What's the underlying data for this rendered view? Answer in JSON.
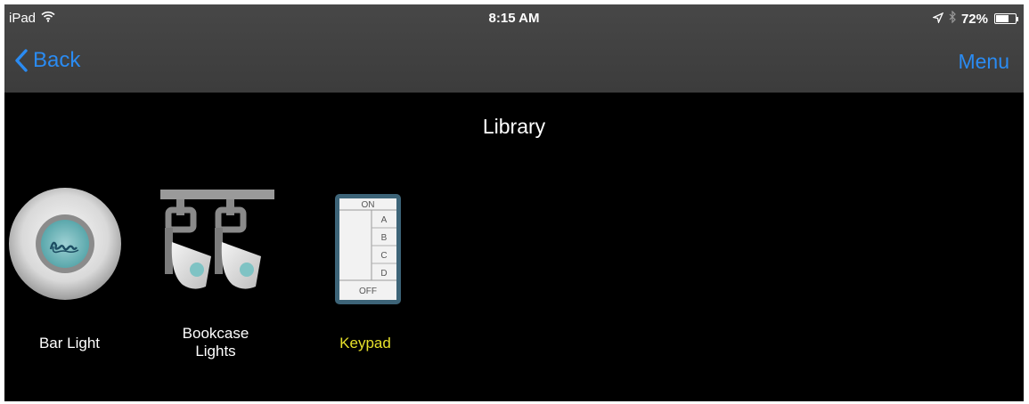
{
  "status_bar": {
    "device": "iPad",
    "time": "8:15 AM",
    "battery": "72%",
    "battery_level": 0.72,
    "icons": [
      "wifi-icon",
      "location-arrow-icon",
      "bluetooth-icon",
      "battery-icon"
    ]
  },
  "nav": {
    "back_label": "Back",
    "menu_label": "Menu"
  },
  "page": {
    "title": "Library"
  },
  "library": {
    "items": [
      {
        "label": "Bar Light",
        "icon": "bar-light-icon",
        "selected": false
      },
      {
        "label": "Bookcase\nLights",
        "icon": "track-lights-icon",
        "selected": false
      },
      {
        "label": "Keypad",
        "icon": "keypad-icon",
        "selected": true
      }
    ],
    "keypad_buttons": [
      "ON",
      "A",
      "B",
      "C",
      "D",
      "OFF"
    ]
  },
  "colors": {
    "accent": "#2a8bf2",
    "selected_label": "#e6e02a",
    "background": "#000000",
    "bar": "#424242"
  }
}
